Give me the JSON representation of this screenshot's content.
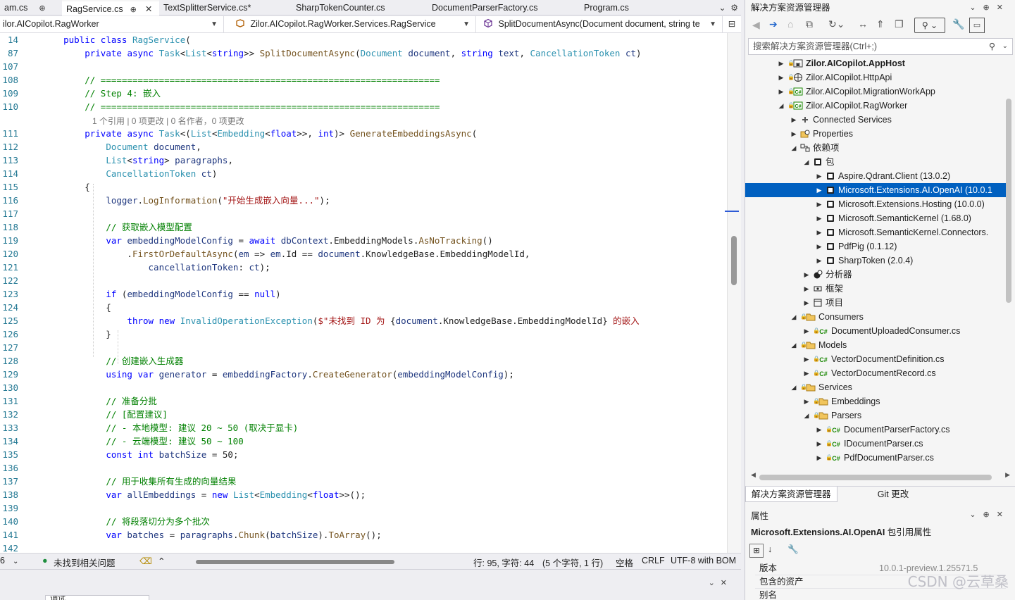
{
  "tabs": [
    {
      "label": "am.cs",
      "suffix": "pin"
    },
    {
      "label": "RagService.cs",
      "active": true,
      "suffix": "pin-close"
    },
    {
      "label": "TextSplitterService.cs*"
    },
    {
      "label": "SharpTokenCounter.cs"
    },
    {
      "label": "DocumentParserFactory.cs"
    },
    {
      "label": "Program.cs"
    }
  ],
  "navbar": {
    "project": "ilor.AICopilot.RagWorker",
    "type": "Zilor.AICopilot.RagWorker.Services.RagService",
    "member": "SplitDocumentAsync(Document document, string te"
  },
  "code_lines": [
    {
      "n": "14",
      "html": "    <span class='kw'>public</span> <span class='kw'>class</span> <span class='ty'>RagService</span>("
    },
    {
      "n": "87",
      "html": "        <span class='kw'>private</span> <span class='kw'>async</span> <span class='ty'>Task</span>&lt;<span class='ty'>List</span>&lt;<span class='kw'>string</span>&gt;&gt; <span class='mt'>SplitDocumentAsync</span>(<span class='ty'>Document</span> <span class='pm'>document</span>, <span class='kw'>string</span> <span class='pm'>text</span>, <span class='ty'>CancellationToken</span> <span class='pm'>ct</span>)"
    },
    {
      "n": "107",
      "html": ""
    },
    {
      "n": "108",
      "html": "        <span class='cm'>// ================================================================</span>"
    },
    {
      "n": "109",
      "html": "        <span class='cm'>// Step 4: 嵌入</span>"
    },
    {
      "n": "110",
      "html": "        <span class='cm'>// ================================================================</span>"
    },
    {
      "n": "",
      "lens": true
    },
    {
      "n": "111",
      "html": "        <span class='kw'>private</span> <span class='kw'>async</span> <span class='ty'>Task</span>&lt;(<span class='ty'>List</span>&lt;<span class='ty'>Embedding</span>&lt;<span class='kw'>float</span>&gt;&gt;, <span class='kw'>int</span>)&gt; <span class='mt'>GenerateEmbeddingsAsync</span>("
    },
    {
      "n": "112",
      "html": "            <span class='ty'>Document</span> <span class='pm'>document</span>,"
    },
    {
      "n": "113",
      "html": "            <span class='ty'>List</span>&lt;<span class='kw'>string</span>&gt; <span class='pm'>paragraphs</span>,"
    },
    {
      "n": "114",
      "html": "            <span class='ty'>CancellationToken</span> <span class='pm'>ct</span>)"
    },
    {
      "n": "115",
      "html": "        {"
    },
    {
      "n": "116",
      "html": "            <span class='pm'>logger</span>.<span class='mt'>LogInformation</span>(<span class='st'>\"开始生成嵌入向量...\"</span>);"
    },
    {
      "n": "117",
      "html": ""
    },
    {
      "n": "118",
      "html": "            <span class='cm'>// 获取嵌入模型配置</span>"
    },
    {
      "n": "119",
      "html": "            <span class='kw'>var</span> <span class='pm'>embeddingModelConfig</span> = <span class='kw'>await</span> <span class='pm'>dbContext</span>.EmbeddingModels.<span class='mt'>AsNoTracking</span>()"
    },
    {
      "n": "120",
      "html": "                .<span class='mt'>FirstOrDefaultAsync</span>(<span class='pm'>em</span> =&gt; <span class='pm'>em</span>.Id == <span class='pm'>document</span>.KnowledgeBase.EmbeddingModelId,"
    },
    {
      "n": "121",
      "html": "                    <span class='pm'>cancellationToken</span>: <span class='pm'>ct</span>);"
    },
    {
      "n": "122",
      "html": ""
    },
    {
      "n": "123",
      "html": "            <span class='kw'>if</span> (<span class='pm'>embeddingModelConfig</span> == <span class='kw'>null</span>)"
    },
    {
      "n": "124",
      "html": "            {"
    },
    {
      "n": "125",
      "html": "                <span class='kw'>throw</span> <span class='kw'>new</span> <span class='ty'>InvalidOperationException</span>(<span class='st'>$\"未找到 ID 为 </span>{<span class='pm'>document</span>.KnowledgeBase.EmbeddingModelId}<span class='st'> 的嵌入</span>"
    },
    {
      "n": "126",
      "html": "            }"
    },
    {
      "n": "127",
      "html": ""
    },
    {
      "n": "128",
      "html": "            <span class='cm'>// 创建嵌入生成器</span>"
    },
    {
      "n": "129",
      "html": "            <span class='kw'>using</span> <span class='kw'>var</span> <span class='pm'>generator</span> = <span class='pm'>embeddingFactory</span>.<span class='mt'>CreateGenerator</span>(<span class='pm'>embeddingModelConfig</span>);"
    },
    {
      "n": "130",
      "html": ""
    },
    {
      "n": "131",
      "html": "            <span class='cm'>// 准备分批</span>"
    },
    {
      "n": "132",
      "html": "            <span class='cm'>// [配置建议]</span>"
    },
    {
      "n": "133",
      "html": "            <span class='cm'>// - 本地模型: 建议 20 ~ 50 (取决于显卡)</span>"
    },
    {
      "n": "134",
      "html": "            <span class='cm'>// - 云端模型: 建议 50 ~ 100</span>"
    },
    {
      "n": "135",
      "html": "            <span class='kw'>const</span> <span class='kw'>int</span> <span class='pm'>batchSize</span> = 50;"
    },
    {
      "n": "136",
      "html": ""
    },
    {
      "n": "137",
      "html": "            <span class='cm'>// 用于收集所有生成的向量结果</span>"
    },
    {
      "n": "138",
      "html": "            <span class='kw'>var</span> <span class='pm'>allEmbeddings</span> = <span class='kw'>new</span> <span class='ty'>List</span>&lt;<span class='ty'>Embedding</span>&lt;<span class='kw'>float</span>&gt;&gt;();"
    },
    {
      "n": "139",
      "html": ""
    },
    {
      "n": "140",
      "html": "            <span class='cm'>// 将段落切分为多个批次</span>"
    },
    {
      "n": "141",
      "html": "            <span class='kw'>var</span> <span class='pm'>batches</span> = <span class='pm'>paragraphs</span>.<span class='mt'>Chunk</span>(<span class='pm'>batchSize</span>).<span class='mt'>ToArray</span>();"
    },
    {
      "n": "142",
      "html": ""
    }
  ],
  "codelens": "1 个引用 | 0 项更改 | 0 名作者，0 项更改",
  "status": {
    "zoom_glyph": "6",
    "issues": "未找到相关问题",
    "position": "行: 95, 字符: 44",
    "selection": "(5 个字符, 1 行)",
    "whitespace": "空格",
    "line_ending": "CRLF",
    "encoding": "UTF-8 with BOM"
  },
  "bottom_panel": {
    "tab1": "调试"
  },
  "solution_explorer": {
    "title": "解决方案资源管理器",
    "search_placeholder": "搜索解决方案资源管理器(Ctrl+;)",
    "tree": [
      {
        "label": "Zilor.AICopilot.AppHost",
        "level": 0,
        "arrow": "▶",
        "icon": "proj",
        "bold": true
      },
      {
        "label": "Zilor.AICopilot.HttpApi",
        "level": 0,
        "arrow": "▶",
        "icon": "globe"
      },
      {
        "label": "Zilor.AICopilot.MigrationWorkApp",
        "level": 0,
        "arrow": "▶",
        "icon": "csproj"
      },
      {
        "label": "Zilor.AICopilot.RagWorker",
        "level": 0,
        "arrow": "◢",
        "icon": "csproj"
      },
      {
        "label": "Connected Services",
        "level": 1,
        "arrow": "▶",
        "icon": "connected"
      },
      {
        "label": "Properties",
        "level": 1,
        "arrow": "▶",
        "icon": "props"
      },
      {
        "label": "依赖项",
        "level": 1,
        "arrow": "◢",
        "icon": "deps"
      },
      {
        "label": "包",
        "level": 2,
        "arrow": "◢",
        "icon": "pkg"
      },
      {
        "label": "Aspire.Qdrant.Client (13.0.2)",
        "level": 3,
        "arrow": "▶",
        "icon": "pkg"
      },
      {
        "label": "Microsoft.Extensions.AI.OpenAI (10.0.1",
        "level": 3,
        "arrow": "▶",
        "icon": "pkg",
        "selected": true
      },
      {
        "label": "Microsoft.Extensions.Hosting (10.0.0)",
        "level": 3,
        "arrow": "▶",
        "icon": "pkg"
      },
      {
        "label": "Microsoft.SemanticKernel (1.68.0)",
        "level": 3,
        "arrow": "▶",
        "icon": "pkg"
      },
      {
        "label": "Microsoft.SemanticKernel.Connectors.",
        "level": 3,
        "arrow": "▶",
        "icon": "pkg"
      },
      {
        "label": "PdfPig (0.1.12)",
        "level": 3,
        "arrow": "▶",
        "icon": "pkg"
      },
      {
        "label": "SharpToken (2.0.4)",
        "level": 3,
        "arrow": "▶",
        "icon": "pkg"
      },
      {
        "label": "分析器",
        "level": 2,
        "arrow": "▶",
        "icon": "analyzer"
      },
      {
        "label": "框架",
        "level": 2,
        "arrow": "▶",
        "icon": "framework"
      },
      {
        "label": "项目",
        "level": 2,
        "arrow": "▶",
        "icon": "project"
      },
      {
        "label": "Consumers",
        "level": 1,
        "arrow": "◢",
        "icon": "folder",
        "lock": true
      },
      {
        "label": "DocumentUploadedConsumer.cs",
        "level": 2,
        "arrow": "▶",
        "icon": "cs",
        "lock": true
      },
      {
        "label": "Models",
        "level": 1,
        "arrow": "◢",
        "icon": "folder",
        "lock": true
      },
      {
        "label": "VectorDocumentDefinition.cs",
        "level": 2,
        "arrow": "▶",
        "icon": "cs",
        "lock": true
      },
      {
        "label": "VectorDocumentRecord.cs",
        "level": 2,
        "arrow": "▶",
        "icon": "cs",
        "lock": true
      },
      {
        "label": "Services",
        "level": 1,
        "arrow": "◢",
        "icon": "folder",
        "lock": true
      },
      {
        "label": "Embeddings",
        "level": 2,
        "arrow": "▶",
        "icon": "folder",
        "lock": true
      },
      {
        "label": "Parsers",
        "level": 2,
        "arrow": "◢",
        "icon": "folder",
        "lock": true
      },
      {
        "label": "DocumentParserFactory.cs",
        "level": 3,
        "arrow": "▶",
        "icon": "cs",
        "lock": true
      },
      {
        "label": "IDocumentParser.cs",
        "level": 3,
        "arrow": "▶",
        "icon": "cs",
        "lock": true
      },
      {
        "label": "PdfDocumentParser.cs",
        "level": 3,
        "arrow": "▶",
        "icon": "cs",
        "lock": true
      }
    ],
    "bottom_tabs": [
      "解决方案资源管理器",
      "Git 更改"
    ]
  },
  "properties": {
    "title": "属性",
    "subject": "Microsoft.Extensions.AI.OpenAI",
    "subject_suffix": "包引用属性",
    "rows": [
      {
        "key": "版本",
        "value": "10.0.1-preview.1.25571.5"
      },
      {
        "key": "包含的资产",
        "value": ""
      },
      {
        "key": "别名",
        "value": ""
      }
    ]
  },
  "watermark": "CSDN @云草桑",
  "colors": {
    "selection": "#0060c0",
    "keyword": "#0000ff",
    "type": "#2b91af",
    "string": "#a31515",
    "comment": "#008000"
  }
}
